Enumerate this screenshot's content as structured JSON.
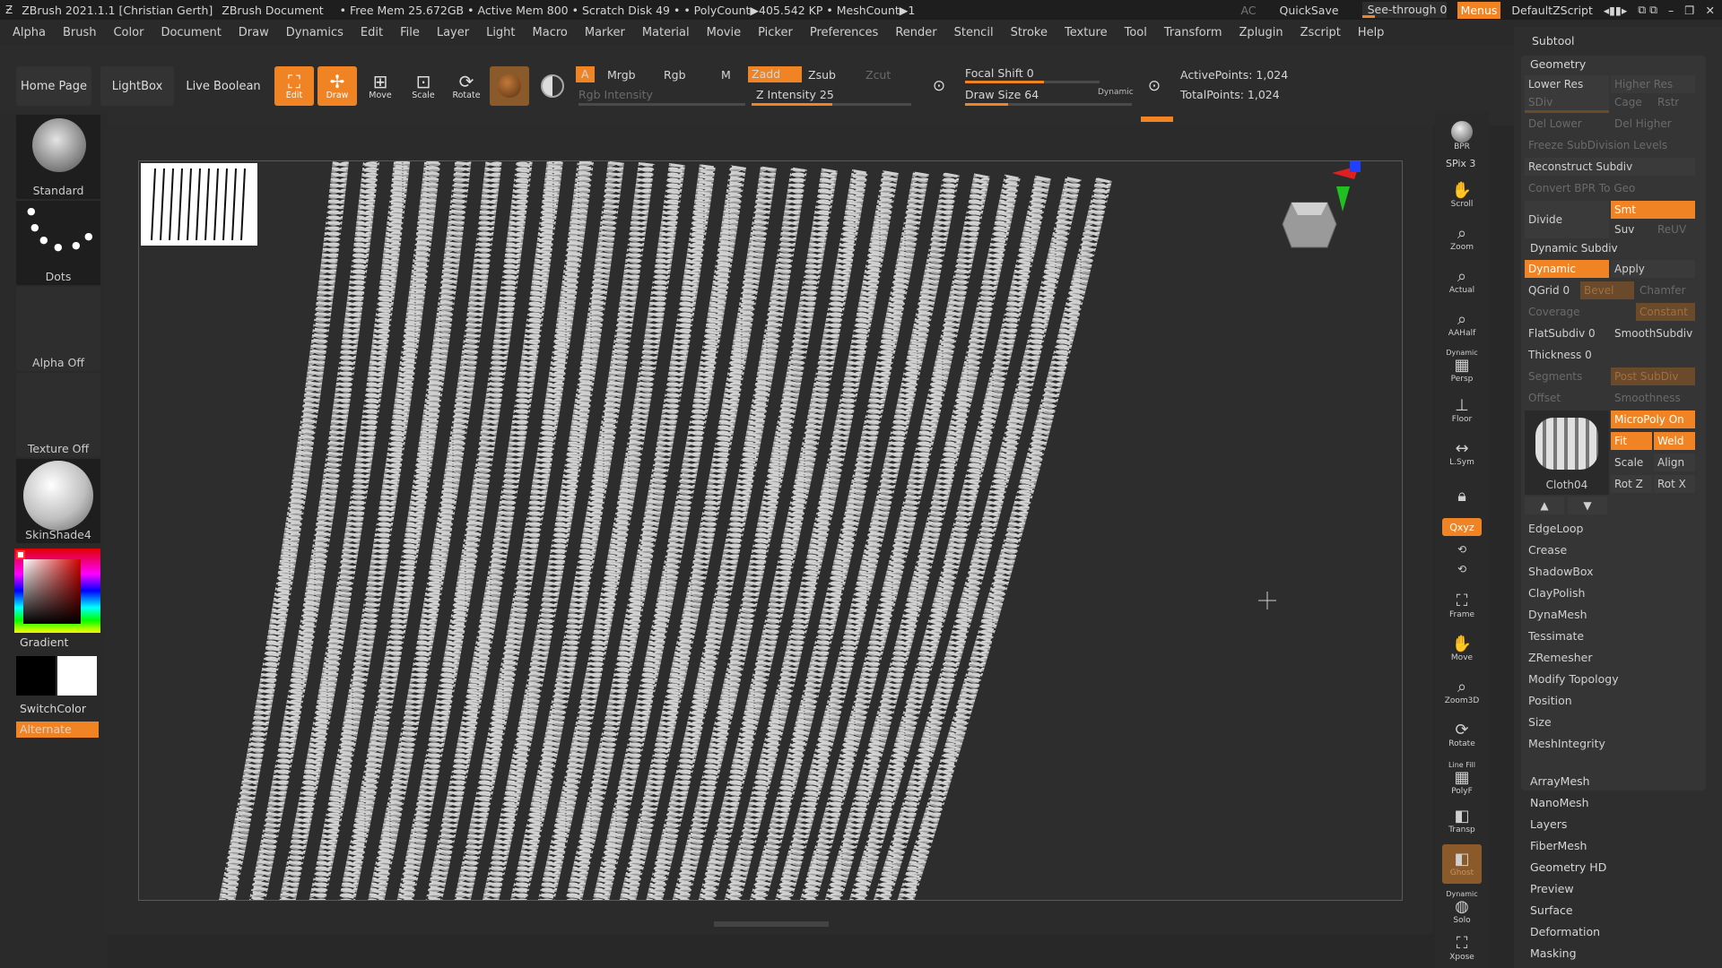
{
  "titlebar": {
    "app": "ZBrush 2021.1.1 [Christian Gerth]",
    "doc": "ZBrush Document",
    "free_mem": "• Free Mem 25.672GB",
    "active_mem": "• Active Mem 800",
    "scratch": "• Scratch Disk 49 •",
    "polycount": "• PolyCount▶405.542 KP",
    "meshcount": "• MeshCount▶1",
    "ac": "AC",
    "quicksave": "QuickSave",
    "seethrough": "See-through 0",
    "menus": "Menus",
    "defaultzscript": "DefaultZScript"
  },
  "menubar": [
    "Alpha",
    "Brush",
    "Color",
    "Document",
    "Draw",
    "Dynamics",
    "Edit",
    "File",
    "Layer",
    "Light",
    "Macro",
    "Marker",
    "Material",
    "Movie",
    "Picker",
    "Preferences",
    "Render",
    "Stencil",
    "Stroke",
    "Texture",
    "Tool",
    "Transform",
    "Zplugin",
    "Zscript",
    "Help"
  ],
  "toolbar": {
    "home": "Home Page",
    "lightbox": "LightBox",
    "liveboolean": "Live Boolean",
    "edit": "Edit",
    "draw": "Draw",
    "move": "Move",
    "scale": "Scale",
    "rotate": "Rotate",
    "a": "A",
    "mrgb": "Mrgb",
    "rgb": "Rgb",
    "m": "M",
    "zadd": "Zadd",
    "zsub": "Zsub",
    "zcut": "Zcut",
    "rgb_intensity": "Rgb Intensity",
    "z_intensity": "Z Intensity 25",
    "z_intensity_value": 25,
    "focal_shift": "Focal Shift 0",
    "draw_size": "Draw Size 64",
    "draw_size_value": 64,
    "dynamic": "Dynamic",
    "active_points": "ActivePoints: 1,024",
    "total_points": "TotalPoints: 1,024"
  },
  "leftshelf": {
    "brush": "Standard",
    "stroke": "Dots",
    "alpha": "Alpha Off",
    "texture": "Texture Off",
    "material": "SkinShade4",
    "gradient": "Gradient",
    "switchcolor": "SwitchColor",
    "alternate": "Alternate"
  },
  "rightshelf": {
    "bpr": "BPR",
    "spix": "SPix 3",
    "scroll": "Scroll",
    "zoom": "Zoom",
    "actual": "Actual",
    "aahalf": "AAHalf",
    "dynamic": "Dynamic",
    "persp": "Persp",
    "floor": "Floor",
    "lsym": "L.Sym",
    "xyz": "Qxyz",
    "frame": "Frame",
    "move": "Move",
    "zoom3d": "Zoom3D",
    "rotate": "Rotate",
    "linefill": "Line Fill",
    "polyf": "PolyF",
    "transp": "Transp",
    "ghost": "Ghost",
    "dynamic2": "Dynamic",
    "solo": "Solo",
    "xpose": "Xpose"
  },
  "panel": {
    "subtool": "Subtool",
    "geometry": "Geometry",
    "lower_res": "Lower Res",
    "higher_res": "Higher Res",
    "sdiv": "SDiv",
    "cage": "Cage",
    "rstr": "Rstr",
    "del_lower": "Del Lower",
    "del_higher": "Del Higher",
    "freeze": "Freeze SubDivision Levels",
    "reconstruct": "Reconstruct Subdiv",
    "convert_bpr": "Convert BPR To Geo",
    "divide": "Divide",
    "smt": "Smt",
    "suv": "Suv",
    "reuv": "ReUV",
    "dynamic_subdiv": "Dynamic Subdiv",
    "dynamic": "Dynamic",
    "apply": "Apply",
    "qgrid": "QGrid 0",
    "bevel": "Bevel",
    "chamfer": "Chamfer",
    "coverage": "Coverage",
    "constant": "Constant",
    "flatsubdiv": "FlatSubdiv 0",
    "smoothsubdiv": "SmoothSubdiv",
    "thickness": "Thickness 0",
    "segments": "Segments",
    "post_subdiv": "Post SubDiv",
    "offset": "Offset",
    "smoothness": "Smoothness",
    "micropoly": "MicroPoly On",
    "fit": "Fit",
    "weld": "Weld",
    "scale": "Scale",
    "align": "Align",
    "rotz": "Rot Z",
    "rotx": "Rot X",
    "mesh_name": "Cloth04",
    "sections": [
      "EdgeLoop",
      "Crease",
      "ShadowBox",
      "ClayPolish",
      "DynaMesh",
      "Tessimate",
      "ZRemesher",
      "Modify Topology",
      "Position",
      "Size",
      "MeshIntegrity"
    ],
    "subtools": [
      "ArrayMesh",
      "NanoMesh",
      "Layers",
      "FiberMesh",
      "Geometry HD",
      "Preview",
      "Surface",
      "Deformation",
      "Masking"
    ]
  },
  "colors": {
    "accent": "#f08424",
    "bg": "#282828",
    "panel": "#353535"
  }
}
